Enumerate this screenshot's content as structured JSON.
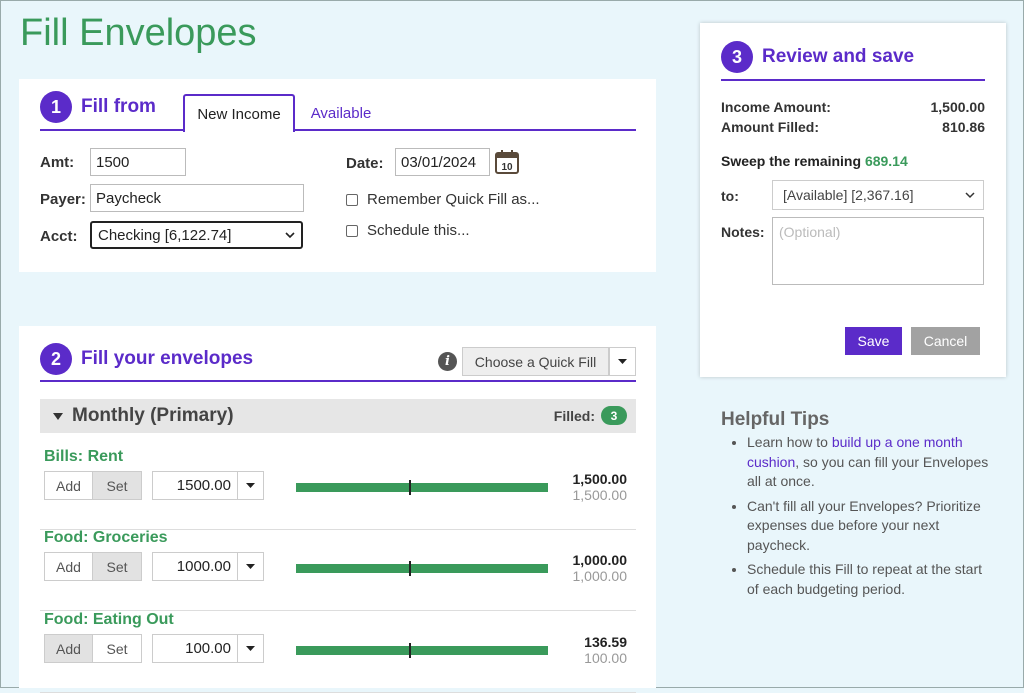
{
  "page": {
    "title": "Fill Envelopes"
  },
  "step1": {
    "number": "1",
    "title": "Fill from",
    "tabs": [
      {
        "label": "New Income",
        "active": true
      },
      {
        "label": "Available",
        "active": false
      }
    ],
    "amt_label": "Amt:",
    "amt_value": "1500",
    "payer_label": "Payer:",
    "payer_value": "Paycheck",
    "acct_label": "Acct:",
    "acct_value": "Checking [6,122.74]",
    "date_label": "Date:",
    "date_value": "03/01/2024",
    "calendar_day": "10",
    "remember_label": "Remember Quick Fill as...",
    "schedule_label": "Schedule this..."
  },
  "step2": {
    "number": "2",
    "title": "Fill your envelopes",
    "info_glyph": "i",
    "quick_fill_label": "Choose a Quick Fill",
    "group": {
      "name": "Monthly (Primary)",
      "filled_label": "Filled:",
      "filled_count": "3"
    },
    "envelopes": [
      {
        "name": "Bills: Rent",
        "add_label": "Add",
        "set_label": "Set",
        "mode": "Set",
        "amount_input": "1500.00",
        "filled": "1,500.00",
        "goal": "1,500.00",
        "fill_fraction": 1.0,
        "mark_fraction": 0.45
      },
      {
        "name": "Food: Groceries",
        "add_label": "Add",
        "set_label": "Set",
        "mode": "Set",
        "amount_input": "1000.00",
        "filled": "1,000.00",
        "goal": "1,000.00",
        "fill_fraction": 1.0,
        "mark_fraction": 0.45
      },
      {
        "name": "Food: Eating Out",
        "add_label": "Add",
        "set_label": "Set",
        "mode": "Add",
        "amount_input": "100.00",
        "filled": "136.59",
        "goal": "100.00",
        "fill_fraction": 1.0,
        "mark_fraction": 0.45
      }
    ]
  },
  "step3": {
    "number": "3",
    "title": "Review and save",
    "income_label": "Income Amount:",
    "income_value": "1,500.00",
    "filled_label": "Amount Filled:",
    "filled_value": "810.86",
    "sweep_label": "Sweep the remaining",
    "sweep_value": "689.14",
    "to_label": "to:",
    "to_value": "[Available] [2,367.16]",
    "notes_label": "Notes:",
    "notes_placeholder": "(Optional)",
    "save_label": "Save",
    "cancel_label": "Cancel"
  },
  "tips": {
    "title": "Helpful Tips",
    "tip1_before": "Learn how to ",
    "tip1_link": "build up a one month cushion",
    "tip1_after": ", so you can fill your Envelopes all at once.",
    "tip2": "Can't fill all your Envelopes? Prioritize expenses due before your next paycheck.",
    "tip3": "Schedule this Fill to repeat at the start of each budgeting period."
  },
  "colors": {
    "accent": "#5b2bc9",
    "green": "#3a9a5b",
    "background": "#e9f6fb"
  },
  "icons": {
    "calendar": "calendar-icon",
    "info": "info-icon",
    "caret": "chevron-down-icon",
    "collapse": "triangle-down-icon"
  }
}
